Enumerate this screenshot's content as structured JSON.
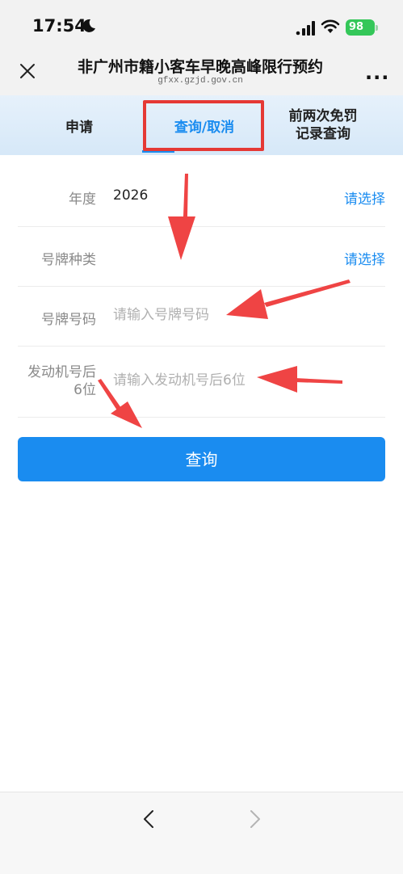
{
  "status_bar": {
    "time": "17:54",
    "battery": "98"
  },
  "header": {
    "close_icon": "close-icon",
    "title": "非广州市籍小客车早晚高峰限行预约",
    "subtitle": "gfxx.gzjd.gov.cn",
    "more": "..."
  },
  "tabs": [
    {
      "label": "申请"
    },
    {
      "label": "查询/取消"
    },
    {
      "label_line1": "前两次免罚",
      "label_line2": "记录查询"
    }
  ],
  "form": {
    "year": {
      "label": "年度",
      "value": "2026",
      "picker": "请选择"
    },
    "plate_type": {
      "label": "号牌种类",
      "picker": "请选择"
    },
    "plate_number": {
      "label": "号牌号码",
      "placeholder": "请输入号牌号码"
    },
    "engine": {
      "label_line1": "发动机号后",
      "label_line2": "6位",
      "placeholder": "请输入发动机号后6位"
    },
    "submit_label": "查询"
  },
  "annotation_color": "#ef4444",
  "bottom_nav": {
    "back_icon": "chevron-left-icon",
    "forward_icon": "chevron-right-icon"
  }
}
